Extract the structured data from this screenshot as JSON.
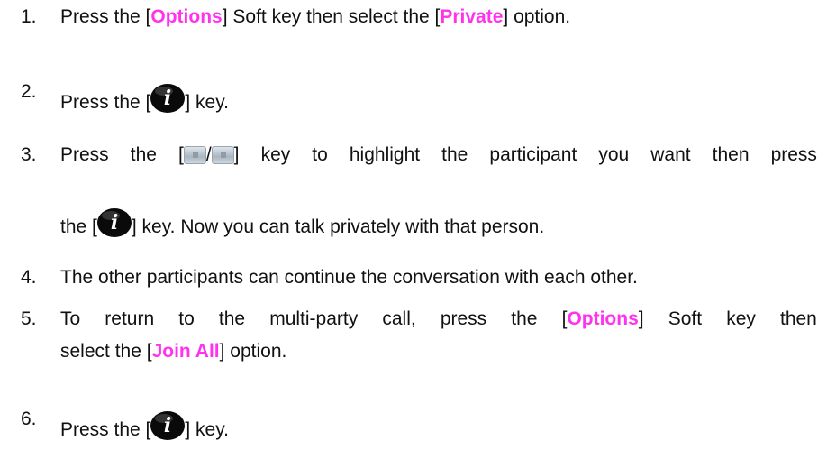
{
  "steps": [
    {
      "number": "1.",
      "parts": [
        "Press the [",
        "Options",
        "] Soft key then select the [",
        "Private",
        "] option."
      ]
    },
    {
      "number": "2.",
      "parts": [
        "Press the [",
        "] key."
      ],
      "key_icon": "info-i-key-icon"
    },
    {
      "number": "3.",
      "line1_words": [
        "Press",
        "the",
        "[",
        "/",
        "]",
        "key",
        "to",
        "highlight",
        "the",
        "participant",
        "you",
        "want",
        "then",
        "press"
      ],
      "line2_parts": [
        "the [",
        "] key. Now you can talk privately with that person."
      ],
      "nav_icons": [
        "nav-up-key-icon",
        "nav-down-key-icon"
      ],
      "key_icon": "info-i-key-icon"
    },
    {
      "number": "4.",
      "text": "The other participants can continue the conversation with each other."
    },
    {
      "number": "5.",
      "line1_words": [
        "To",
        "return",
        "to",
        "the",
        "multi-party",
        "call,",
        "press",
        "the",
        "[Options]",
        "Soft",
        "key",
        "then"
      ],
      "line1_parts": [
        "To return to the multi-party call, press the [",
        "Options",
        "] Soft key then"
      ],
      "line2_parts": [
        "select the [",
        "Join All",
        "] option."
      ]
    },
    {
      "number": "6.",
      "parts": [
        "Press the [",
        "] key."
      ],
      "key_icon": "info-i-key-icon"
    }
  ],
  "colors": {
    "highlight": "#ff33ee",
    "text": "#111111",
    "key": "#111111"
  }
}
